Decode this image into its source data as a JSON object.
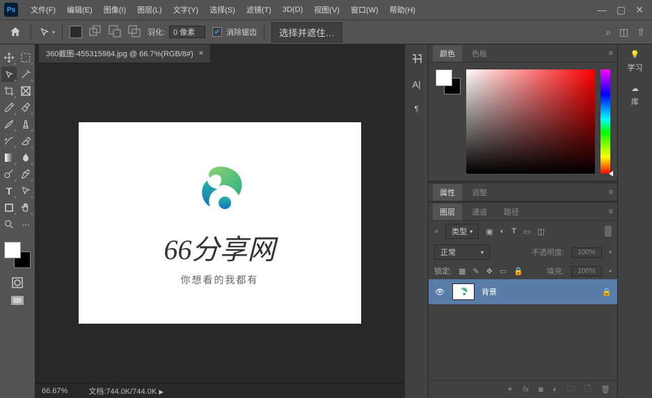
{
  "menu": [
    "文件(F)",
    "编辑(E)",
    "图像(I)",
    "图层(L)",
    "文字(Y)",
    "选择(S)",
    "滤镜(T)",
    "3D(D)",
    "视图(V)",
    "窗口(W)",
    "帮助(H)"
  ],
  "options": {
    "feather_label": "羽化:",
    "feather_value": "0 像素",
    "antialias": "消除锯齿",
    "select_mask": "选择并遮住…"
  },
  "doc": {
    "tab": "360截图-455315984.jpg @ 66.7%(RGB/8#)",
    "zoom": "66.67%",
    "status_label": "文档:",
    "status_value": "744.0K/744.0K"
  },
  "brand": {
    "title": "66分享网",
    "sub": "你想看的我都有"
  },
  "panels": {
    "color": "颜色",
    "swatches": "色板",
    "properties": "属性",
    "adjustments": "调整",
    "layers": "图层",
    "channels": "通道",
    "paths": "路径",
    "filter_kind": "类型",
    "blend_mode": "正常",
    "opacity_label": "不透明度:",
    "opacity": "100%",
    "lock_label": "锁定:",
    "fill_label": "填充:",
    "fill": "100%",
    "layer_name": "背景",
    "learn": "学习",
    "library": "库"
  }
}
